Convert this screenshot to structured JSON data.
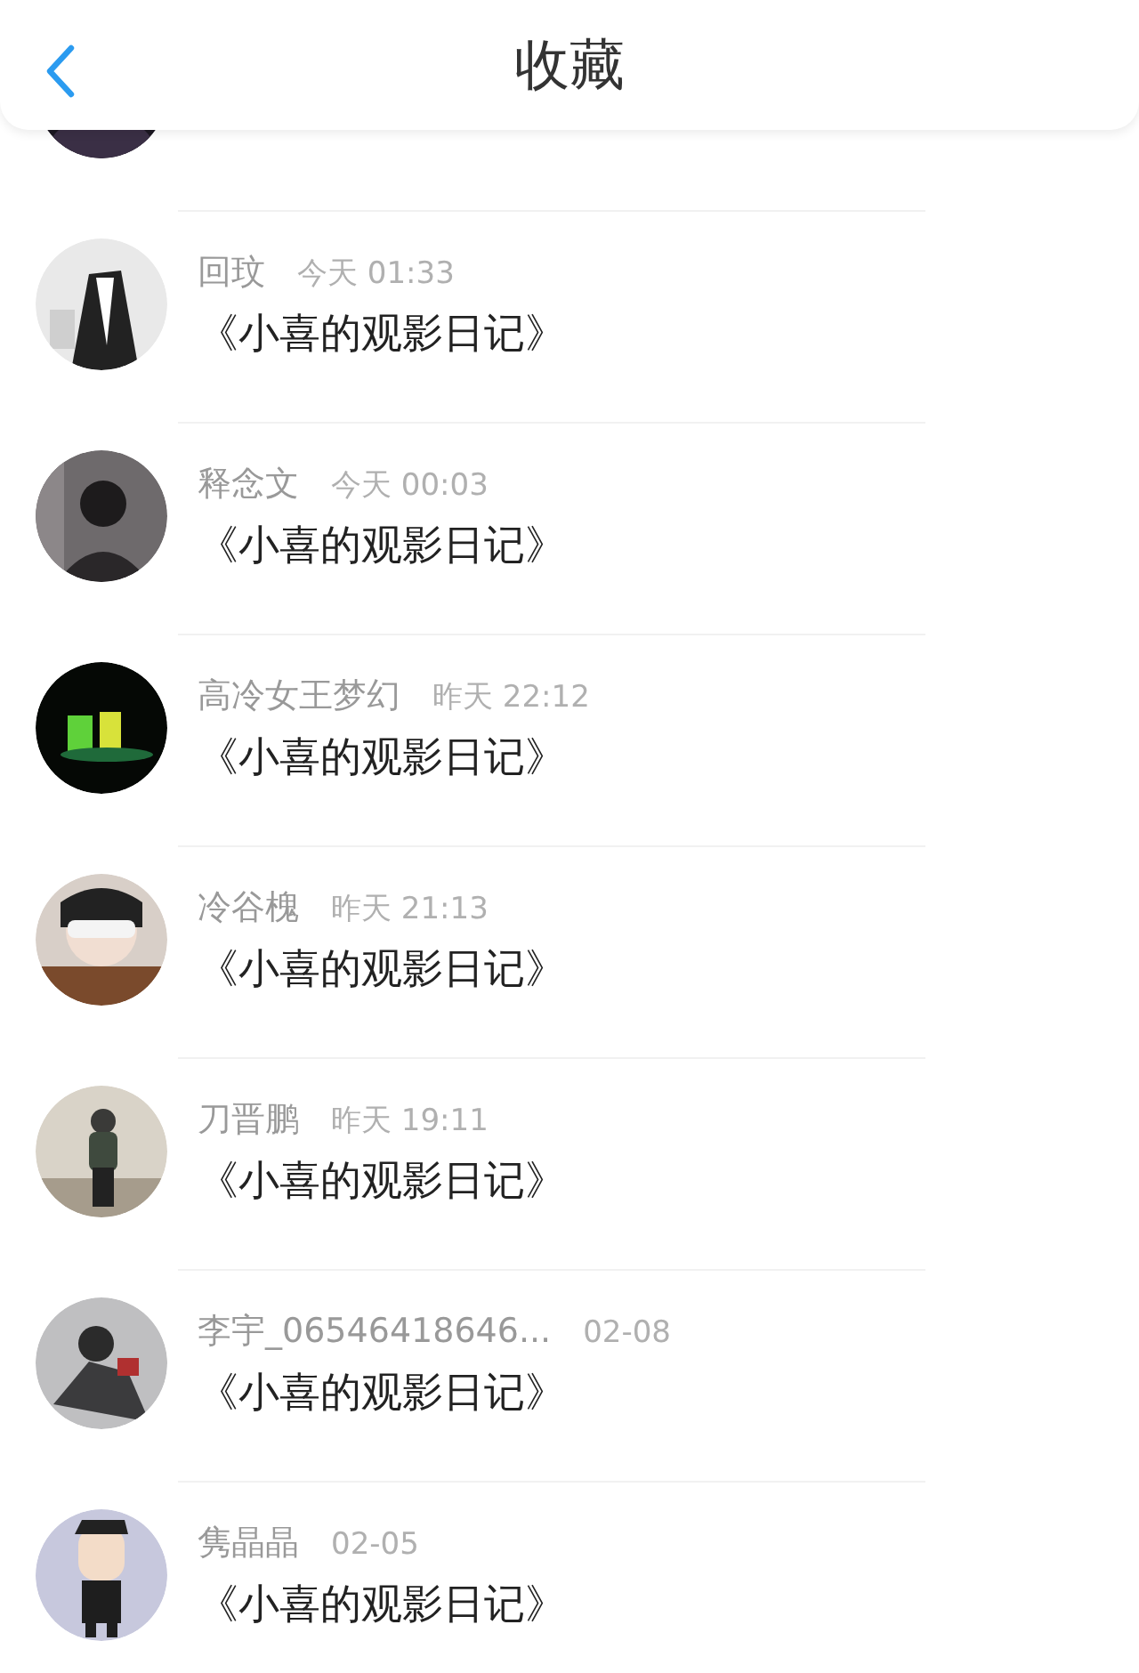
{
  "header": {
    "title": "收藏"
  },
  "items": [
    {
      "name": "回玟",
      "time": "今天 01:33",
      "title": "《小喜的观影日记》"
    },
    {
      "name": "释念文",
      "time": "今天 00:03",
      "title": "《小喜的观影日记》"
    },
    {
      "name": "高冷女王梦幻",
      "time": "昨天 22:12",
      "title": "《小喜的观影日记》"
    },
    {
      "name": "冷谷槐",
      "time": "昨天 21:13",
      "title": "《小喜的观影日记》"
    },
    {
      "name": "刀晋鹏",
      "time": "昨天 19:11",
      "title": "《小喜的观影日记》"
    },
    {
      "name": "李宇_06546418646...",
      "time": "02-08",
      "title": "《小喜的观影日记》"
    },
    {
      "name": "隽晶晶",
      "time": "02-05",
      "title": "《小喜的观影日记》"
    }
  ]
}
